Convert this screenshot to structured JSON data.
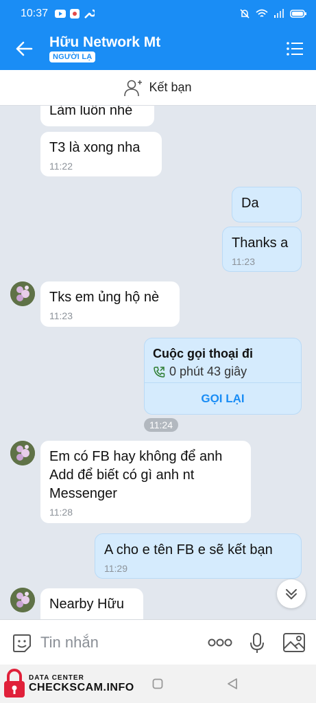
{
  "status_bar": {
    "time": "10:37",
    "battery_icon": "battery-icon",
    "wifi_icon": "wifi-icon"
  },
  "header": {
    "contact_name": "Hữu Network Mt",
    "badge": "NGƯỜI LẠ",
    "back_icon": "back-arrow-icon",
    "menu_icon": "menu-list-icon"
  },
  "add_friend": {
    "label": "Kết bạn",
    "icon": "add-person-icon"
  },
  "messages": [
    {
      "dir": "in",
      "text": "Làm luôn nhé",
      "time": ""
    },
    {
      "dir": "in",
      "text": "T3 là xong nha",
      "time": "11:22"
    },
    {
      "dir": "out",
      "text": "Da",
      "time": ""
    },
    {
      "dir": "out",
      "text": "Thanks a",
      "time": "11:23"
    },
    {
      "dir": "in",
      "text": "Tks em ủng hộ nè",
      "time": "11:23"
    },
    {
      "dir": "in",
      "text": "Em có FB hay không để anh Add để biết có gì anh nt Messenger",
      "time": "11:28"
    },
    {
      "dir": "out",
      "text": "A cho e tên FB e sẽ kết bạn",
      "time": "11:29"
    },
    {
      "dir": "in",
      "text": "Nearby Hữu",
      "time": ""
    }
  ],
  "call_card": {
    "title": "Cuộc gọi thoại đi",
    "duration": "0 phút 43 giây",
    "callback_label": "GỌI LẠI",
    "time": "11:24"
  },
  "input": {
    "placeholder": "Tin nhắn"
  },
  "watermark": {
    "line1": "DATA CENTER",
    "line2": "CHECKSCAM.INFO"
  },
  "colors": {
    "brand": "#1a8df5",
    "out_bubble": "#d5ebfd",
    "background": "#e2e7ee"
  }
}
